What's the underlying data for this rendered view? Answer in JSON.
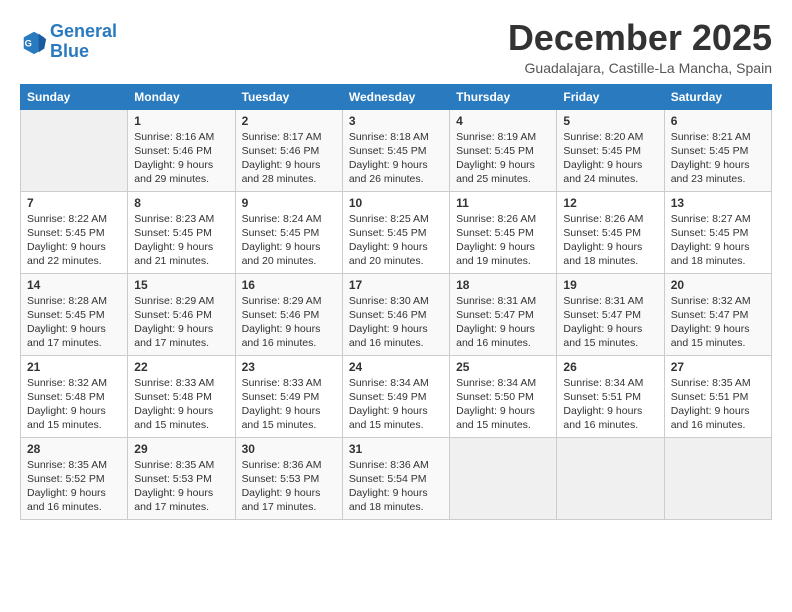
{
  "logo": {
    "line1": "General",
    "line2": "Blue"
  },
  "title": "December 2025",
  "subtitle": "Guadalajara, Castille-La Mancha, Spain",
  "weekdays": [
    "Sunday",
    "Monday",
    "Tuesday",
    "Wednesday",
    "Thursday",
    "Friday",
    "Saturday"
  ],
  "weeks": [
    [
      {
        "day": "",
        "info": ""
      },
      {
        "day": "1",
        "info": "Sunrise: 8:16 AM\nSunset: 5:46 PM\nDaylight: 9 hours\nand 29 minutes."
      },
      {
        "day": "2",
        "info": "Sunrise: 8:17 AM\nSunset: 5:46 PM\nDaylight: 9 hours\nand 28 minutes."
      },
      {
        "day": "3",
        "info": "Sunrise: 8:18 AM\nSunset: 5:45 PM\nDaylight: 9 hours\nand 26 minutes."
      },
      {
        "day": "4",
        "info": "Sunrise: 8:19 AM\nSunset: 5:45 PM\nDaylight: 9 hours\nand 25 minutes."
      },
      {
        "day": "5",
        "info": "Sunrise: 8:20 AM\nSunset: 5:45 PM\nDaylight: 9 hours\nand 24 minutes."
      },
      {
        "day": "6",
        "info": "Sunrise: 8:21 AM\nSunset: 5:45 PM\nDaylight: 9 hours\nand 23 minutes."
      }
    ],
    [
      {
        "day": "7",
        "info": "Sunrise: 8:22 AM\nSunset: 5:45 PM\nDaylight: 9 hours\nand 22 minutes."
      },
      {
        "day": "8",
        "info": "Sunrise: 8:23 AM\nSunset: 5:45 PM\nDaylight: 9 hours\nand 21 minutes."
      },
      {
        "day": "9",
        "info": "Sunrise: 8:24 AM\nSunset: 5:45 PM\nDaylight: 9 hours\nand 20 minutes."
      },
      {
        "day": "10",
        "info": "Sunrise: 8:25 AM\nSunset: 5:45 PM\nDaylight: 9 hours\nand 20 minutes."
      },
      {
        "day": "11",
        "info": "Sunrise: 8:26 AM\nSunset: 5:45 PM\nDaylight: 9 hours\nand 19 minutes."
      },
      {
        "day": "12",
        "info": "Sunrise: 8:26 AM\nSunset: 5:45 PM\nDaylight: 9 hours\nand 18 minutes."
      },
      {
        "day": "13",
        "info": "Sunrise: 8:27 AM\nSunset: 5:45 PM\nDaylight: 9 hours\nand 18 minutes."
      }
    ],
    [
      {
        "day": "14",
        "info": "Sunrise: 8:28 AM\nSunset: 5:45 PM\nDaylight: 9 hours\nand 17 minutes."
      },
      {
        "day": "15",
        "info": "Sunrise: 8:29 AM\nSunset: 5:46 PM\nDaylight: 9 hours\nand 17 minutes."
      },
      {
        "day": "16",
        "info": "Sunrise: 8:29 AM\nSunset: 5:46 PM\nDaylight: 9 hours\nand 16 minutes."
      },
      {
        "day": "17",
        "info": "Sunrise: 8:30 AM\nSunset: 5:46 PM\nDaylight: 9 hours\nand 16 minutes."
      },
      {
        "day": "18",
        "info": "Sunrise: 8:31 AM\nSunset: 5:47 PM\nDaylight: 9 hours\nand 16 minutes."
      },
      {
        "day": "19",
        "info": "Sunrise: 8:31 AM\nSunset: 5:47 PM\nDaylight: 9 hours\nand 15 minutes."
      },
      {
        "day": "20",
        "info": "Sunrise: 8:32 AM\nSunset: 5:47 PM\nDaylight: 9 hours\nand 15 minutes."
      }
    ],
    [
      {
        "day": "21",
        "info": "Sunrise: 8:32 AM\nSunset: 5:48 PM\nDaylight: 9 hours\nand 15 minutes."
      },
      {
        "day": "22",
        "info": "Sunrise: 8:33 AM\nSunset: 5:48 PM\nDaylight: 9 hours\nand 15 minutes."
      },
      {
        "day": "23",
        "info": "Sunrise: 8:33 AM\nSunset: 5:49 PM\nDaylight: 9 hours\nand 15 minutes."
      },
      {
        "day": "24",
        "info": "Sunrise: 8:34 AM\nSunset: 5:49 PM\nDaylight: 9 hours\nand 15 minutes."
      },
      {
        "day": "25",
        "info": "Sunrise: 8:34 AM\nSunset: 5:50 PM\nDaylight: 9 hours\nand 15 minutes."
      },
      {
        "day": "26",
        "info": "Sunrise: 8:34 AM\nSunset: 5:51 PM\nDaylight: 9 hours\nand 16 minutes."
      },
      {
        "day": "27",
        "info": "Sunrise: 8:35 AM\nSunset: 5:51 PM\nDaylight: 9 hours\nand 16 minutes."
      }
    ],
    [
      {
        "day": "28",
        "info": "Sunrise: 8:35 AM\nSunset: 5:52 PM\nDaylight: 9 hours\nand 16 minutes."
      },
      {
        "day": "29",
        "info": "Sunrise: 8:35 AM\nSunset: 5:53 PM\nDaylight: 9 hours\nand 17 minutes."
      },
      {
        "day": "30",
        "info": "Sunrise: 8:36 AM\nSunset: 5:53 PM\nDaylight: 9 hours\nand 17 minutes."
      },
      {
        "day": "31",
        "info": "Sunrise: 8:36 AM\nSunset: 5:54 PM\nDaylight: 9 hours\nand 18 minutes."
      },
      {
        "day": "",
        "info": ""
      },
      {
        "day": "",
        "info": ""
      },
      {
        "day": "",
        "info": ""
      }
    ]
  ]
}
